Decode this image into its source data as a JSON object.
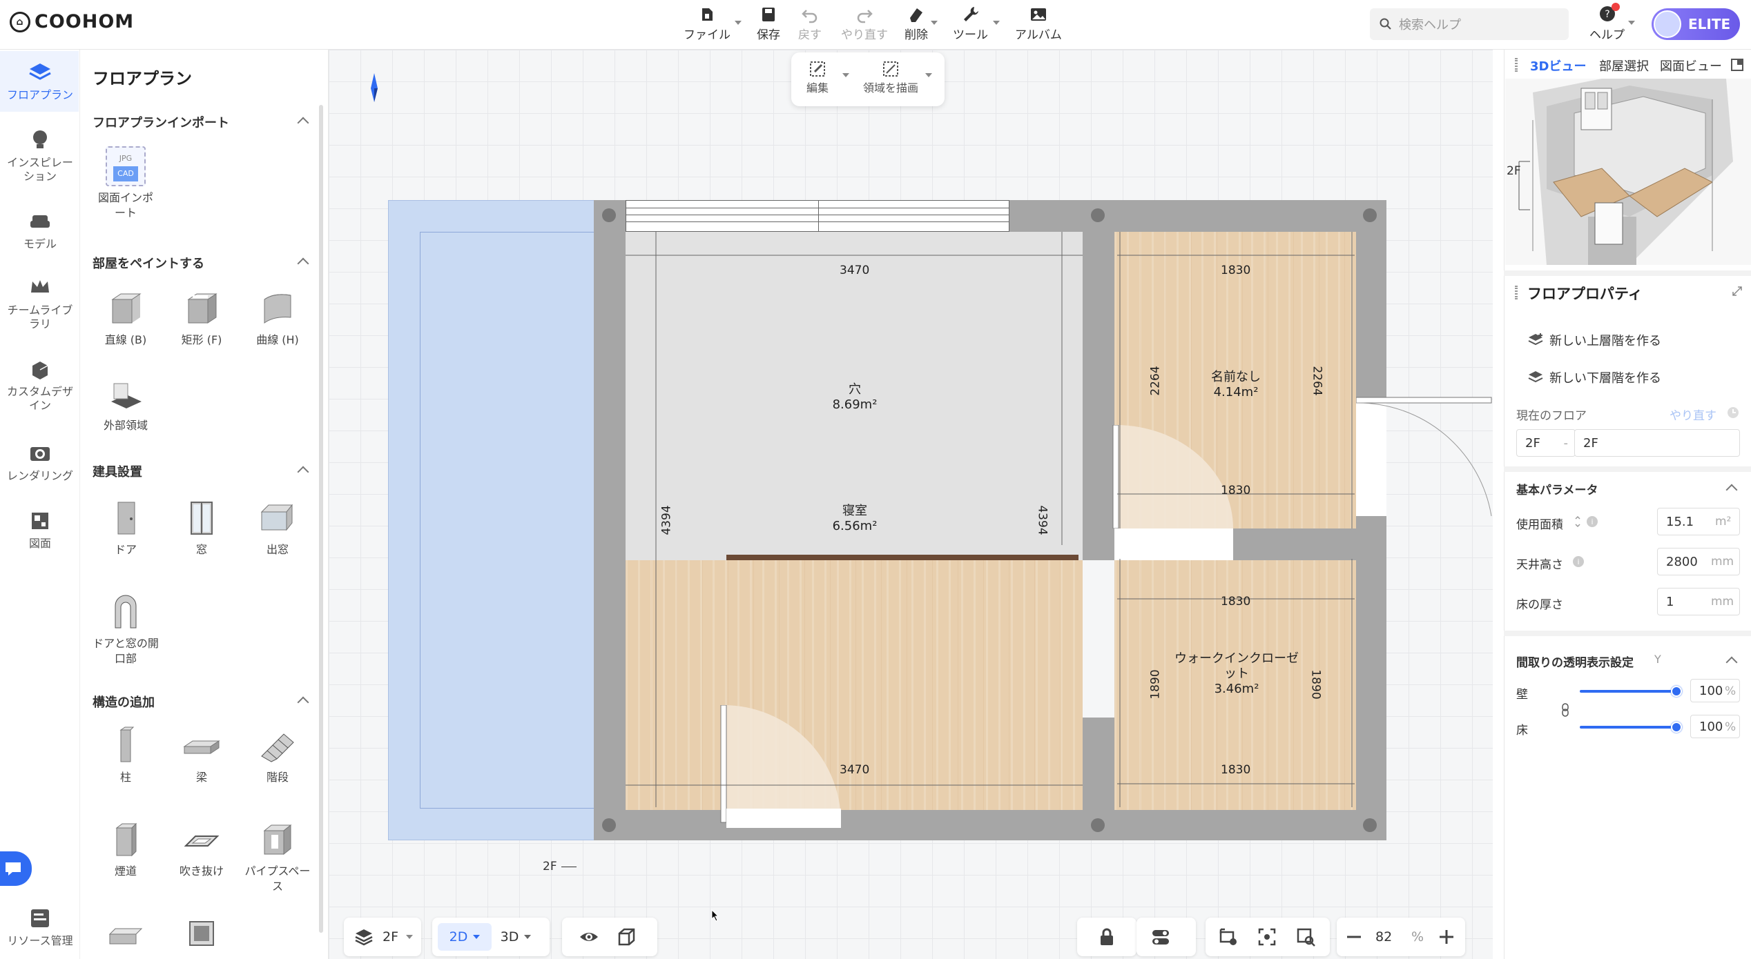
{
  "app": {
    "logo": "COOHOM"
  },
  "toolbar": {
    "file": "ファイル",
    "save": "保存",
    "undo": "戻す",
    "redo": "やり直す",
    "delete": "削除",
    "tools": "ツール",
    "album": "アルバム"
  },
  "search": {
    "placeholder": "検索ヘルプ"
  },
  "help": "ヘルプ",
  "plan_badge": "ELITE",
  "leftnav": {
    "floorplan": "フロアプラン",
    "inspiration": "インスピレーション",
    "model": "モデル",
    "team_library": "チームライブラリ",
    "custom_design": "カスタムデザイン",
    "rendering": "レンダリング",
    "drawing": "図面",
    "resource": "リソース管理"
  },
  "panel": {
    "title": "フロアプラン",
    "import_section": "フロアプランインポート",
    "import_item": "図面インポート",
    "import_badge_top": "JPG",
    "import_badge_bottom": "CAD",
    "paint_section": "部屋をペイントする",
    "paint_items": [
      "直線 (B)",
      "矩形 (F)",
      "曲線 (H)",
      "外部領域"
    ],
    "fixture_section": "建具設置",
    "fixture_items": [
      "ドア",
      "窓",
      "出窓",
      "ドアと窓の開口部"
    ],
    "structure_section": "構造の追加",
    "structure_items": [
      "柱",
      "梁",
      "階段",
      "煙道",
      "吹き抜け",
      "パイプスペース"
    ]
  },
  "subtool": {
    "edit": "編集",
    "draw_area": "領域を描画"
  },
  "plan": {
    "dims": {
      "top_left": "3470",
      "top_right": "1830",
      "mid_right_top": "1830",
      "left_height": "4394",
      "right_height": "4394",
      "room_right_h": "2264",
      "wic_top": "1830",
      "wic_bottom": "1830",
      "wic_h": "1890",
      "bottom_left": "3470"
    },
    "rooms": [
      {
        "name": "穴",
        "area": "8.69m²"
      },
      {
        "name": "寝室",
        "area": "6.56m²"
      },
      {
        "name": "名前なし",
        "area": "4.14m²"
      },
      {
        "name": "ウォークインクローゼット",
        "area": "3.46m²"
      }
    ],
    "floor_tag": "2F"
  },
  "bottom": {
    "floor": "2F",
    "mode2d": "2D",
    "mode3d": "3D",
    "zoom": "82",
    "zoom_unit": "%"
  },
  "right": {
    "tabs": [
      "3Dビュー",
      "部屋選択",
      "図面ビュー"
    ],
    "preview_floor": "2F",
    "props_title": "フロアプロパティ",
    "new_upper": "新しい上層階を作る",
    "new_lower": "新しい下層階を作る",
    "current_floor_label": "現在のフロア",
    "redo_link": "やり直す",
    "floor_select": "2F",
    "floor_name": "2F",
    "basic_section": "基本パラメータ",
    "area_label": "使用面積",
    "area_value": "15.1",
    "area_unit": "m²",
    "ceiling_label": "天井高さ",
    "ceiling_value": "2800",
    "ceiling_unit": "mm",
    "floor_thick_label": "床の厚さ",
    "floor_thick_value": "1",
    "floor_thick_unit": "mm",
    "transparency_section": "間取りの透明表示設定",
    "transparency_flag": "Y",
    "wall_label": "壁",
    "wall_value": "100",
    "floor_label": "床",
    "floor_value": "100",
    "percent": "%"
  },
  "colors": {
    "accent": "#2f6bf2",
    "wall": "#a6a6a6",
    "wood": "#e8cfae",
    "badge": "#6a5ae8"
  }
}
